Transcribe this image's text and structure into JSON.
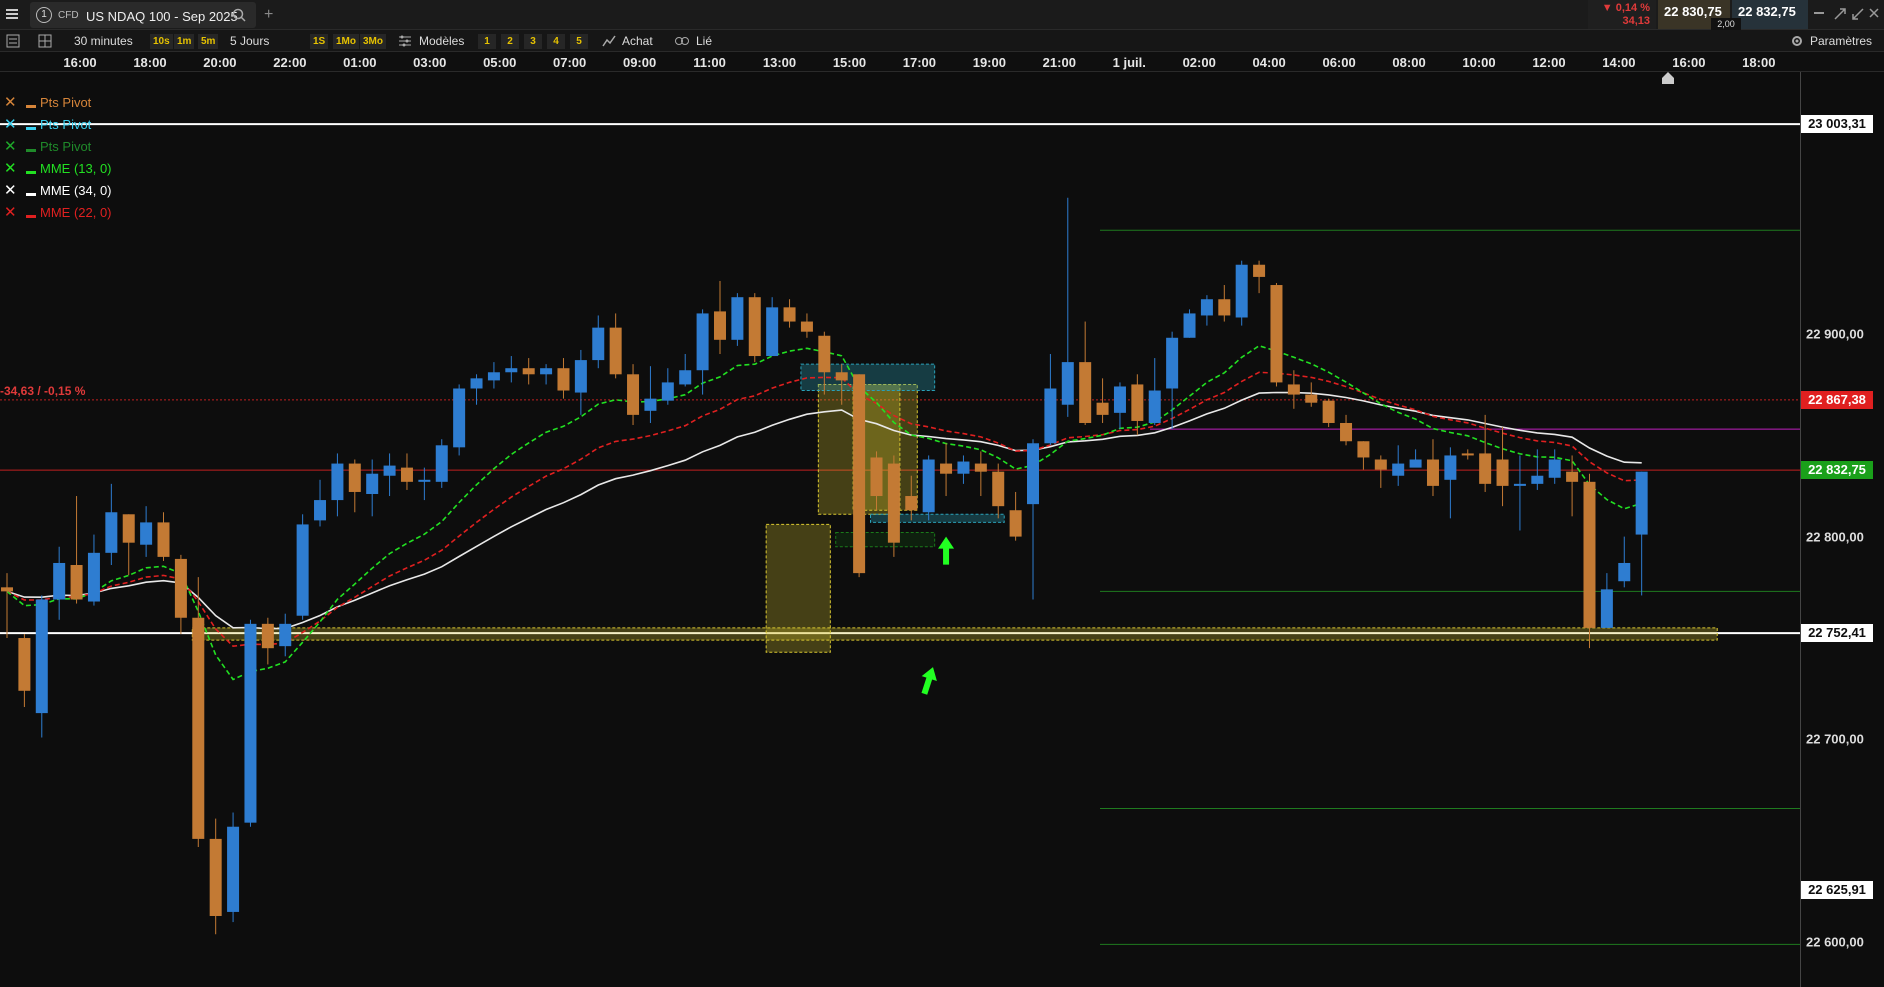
{
  "window": {
    "tab_number": "1",
    "tab_type": "CFD",
    "tab_title": "US NDAQ 100 - Sep 2025",
    "change_pct": "▼ 0,14 %",
    "change_abs": "34,13",
    "bid": "22 830,75",
    "ask": "22 832,75",
    "spread": "2,00"
  },
  "toolbar": {
    "interval": "30 minutes",
    "quick_intervals": [
      "10s",
      "1m",
      "5m"
    ],
    "period": "5 Jours",
    "quick_periods": [
      "1S",
      "1Mo",
      "3Mo"
    ],
    "models_label": "Modèles",
    "layout_buttons": [
      "1",
      "2",
      "3",
      "4",
      "5"
    ],
    "buy_label": "Achat",
    "link_label": "Lié",
    "settings_label": "Paramètres"
  },
  "time_axis": [
    "16:00",
    "18:00",
    "20:00",
    "22:00",
    "01:00",
    "03:00",
    "05:00",
    "07:00",
    "09:00",
    "11:00",
    "13:00",
    "15:00",
    "17:00",
    "19:00",
    "21:00",
    "1 juil.",
    "02:00",
    "04:00",
    "06:00",
    "08:00",
    "10:00",
    "12:00",
    "14:00",
    "16:00",
    "18:00"
  ],
  "legend": [
    {
      "label": "Pts Pivot",
      "color": "#d6853a",
      "x_color": "#d6853a"
    },
    {
      "label": "Pts Pivot",
      "color": "#3ad0f0",
      "x_color": "#3ad0f0"
    },
    {
      "label": "Pts Pivot",
      "color": "#1f8a2a",
      "x_color": "#1faa2a"
    },
    {
      "label": "MME (13, 0)",
      "color": "#22e022",
      "x_color": "#22e022"
    },
    {
      "label": "MME (34, 0)",
      "color": "#ffffff",
      "x_color": "#ffffff"
    },
    {
      "label": "MME (22, 0)",
      "color": "#e02020",
      "x_color": "#e02020"
    }
  ],
  "annotations": {
    "prev_close_change": "-34,63 / -0,15 %"
  },
  "price_axis": {
    "ticks": [
      "22 900,00",
      "22 800,00",
      "22 700,00",
      "22 600,00"
    ],
    "top_box": "23 003,31",
    "prev_close_box": "22 867,38",
    "last_box": "22 832,75",
    "support_box": "22 752,41",
    "low_box": "22 625,91"
  },
  "colors": {
    "bull": "#2e7dd1",
    "bear": "#c37a34",
    "ema13": "#22e022",
    "ema22": "#e02020",
    "ema34": "#e8e8e8",
    "pivot": "#1f7a1f",
    "zone": "#d8c630"
  },
  "chart_data": {
    "type": "candlestick",
    "instrument": "US NDAQ 100 - Sep 2025",
    "interval": "30 minutes",
    "ylim": [
      22578,
      23029
    ],
    "reference_levels": {
      "r_top": 23003.31,
      "pivot_r1": 22951,
      "prev_close": 22867.38,
      "magenta": 22853,
      "last": 22832.75,
      "pivot_s1": 22773,
      "support": 22752.41,
      "pivot_s2": 22666,
      "low": 22625.91,
      "pivot_s3": 22599
    },
    "candles": [
      [
        22775,
        22773,
        22782,
        22750
      ],
      [
        22750,
        22724,
        22752,
        22716
      ],
      [
        22713,
        22769,
        22771,
        22701
      ],
      [
        22769,
        22787,
        22795,
        22759
      ],
      [
        22786,
        22769,
        22820,
        22767
      ],
      [
        22768,
        22792,
        22801,
        22766
      ],
      [
        22792,
        22812,
        22826,
        22786
      ],
      [
        22811,
        22797,
        22811,
        22781
      ],
      [
        22796,
        22807,
        22815,
        22790
      ],
      [
        22807,
        22790,
        22812,
        22788
      ],
      [
        22789,
        22760,
        22791,
        22752
      ],
      [
        22760,
        22651,
        22780,
        22647
      ],
      [
        22651,
        22613,
        22661,
        22604
      ],
      [
        22615,
        22657,
        22664,
        22610
      ],
      [
        22659,
        22757,
        22759,
        22657
      ],
      [
        22757,
        22745,
        22760,
        22737
      ],
      [
        22746,
        22757,
        22762,
        22741
      ],
      [
        22761,
        22806,
        22811,
        22759
      ],
      [
        22808,
        22818,
        22828,
        22805
      ],
      [
        22818,
        22836,
        22841,
        22810
      ],
      [
        22836,
        22822,
        22838,
        22812
      ],
      [
        22821,
        22831,
        22838,
        22810
      ],
      [
        22830,
        22835,
        22841,
        22820
      ],
      [
        22834,
        22827,
        22841,
        22823
      ],
      [
        22827,
        22828,
        22834,
        22818
      ],
      [
        22827,
        22845,
        22848,
        22824
      ],
      [
        22844,
        22873,
        22875,
        22840
      ],
      [
        22873,
        22878,
        22880,
        22865
      ],
      [
        22877,
        22881,
        22886,
        22873
      ],
      [
        22881,
        22883,
        22889,
        22876
      ],
      [
        22883,
        22880,
        22888,
        22875
      ],
      [
        22880,
        22883,
        22885,
        22875
      ],
      [
        22883,
        22872,
        22888,
        22868
      ],
      [
        22871,
        22887,
        22892,
        22860
      ],
      [
        22887,
        22903,
        22909,
        22883
      ],
      [
        22903,
        22880,
        22910,
        22878
      ],
      [
        22880,
        22860,
        22885,
        22855
      ],
      [
        22862,
        22868,
        22884,
        22856
      ],
      [
        22867,
        22876,
        22883,
        22865
      ],
      [
        22875,
        22882,
        22890,
        22874
      ],
      [
        22882,
        22910,
        22912,
        22870
      ],
      [
        22911,
        22897,
        22926,
        22890
      ],
      [
        22897,
        22918,
        22920,
        22894
      ],
      [
        22918,
        22889,
        22920,
        22886
      ],
      [
        22889,
        22913,
        22918,
        22893
      ],
      [
        22913,
        22906,
        22917,
        22903
      ],
      [
        22906,
        22901,
        22910,
        22898
      ],
      [
        22899,
        22881,
        22901,
        22870
      ],
      [
        22881,
        22877,
        22885,
        22865
      ],
      [
        22880,
        22782,
        22880,
        22780
      ],
      [
        22839,
        22820,
        22842,
        22813
      ],
      [
        22836,
        22797,
        22840,
        22790
      ],
      [
        22820,
        22813,
        22830,
        22808
      ],
      [
        22812,
        22838,
        22840,
        22808
      ],
      [
        22836,
        22831,
        22846,
        22820
      ],
      [
        22831,
        22837,
        22840,
        22826
      ],
      [
        22836,
        22832,
        22842,
        22820
      ],
      [
        22832,
        22815,
        22836,
        22809
      ],
      [
        22813,
        22800,
        22822,
        22798
      ],
      [
        22816,
        22846,
        22848,
        22769
      ],
      [
        22846,
        22873,
        22890,
        22845
      ],
      [
        22865,
        22886,
        22967,
        22859
      ],
      [
        22886,
        22856,
        22906,
        22855
      ],
      [
        22866,
        22860,
        22878,
        22856
      ],
      [
        22861,
        22874,
        22876,
        22853
      ],
      [
        22875,
        22857,
        22880,
        22850
      ],
      [
        22856,
        22872,
        22888,
        22855
      ],
      [
        22873,
        22898,
        22901,
        22853
      ],
      [
        22898,
        22910,
        22912,
        22898
      ],
      [
        22909,
        22917,
        22919,
        22904
      ],
      [
        22917,
        22909,
        22924,
        22906
      ],
      [
        22908,
        22934,
        22936,
        22904
      ],
      [
        22934,
        22928,
        22936,
        22920
      ],
      [
        22924,
        22876,
        22925,
        22874
      ],
      [
        22875,
        22870,
        22882,
        22863
      ],
      [
        22870,
        22866,
        22876,
        22864
      ],
      [
        22867,
        22856,
        22868,
        22854
      ],
      [
        22856,
        22847,
        22860,
        22845
      ],
      [
        22847,
        22839,
        22847,
        22833
      ],
      [
        22838,
        22833,
        22840,
        22824
      ],
      [
        22830,
        22836,
        22845,
        22825
      ],
      [
        22834,
        22838,
        22843,
        22835
      ],
      [
        22838,
        22825,
        22848,
        22820
      ],
      [
        22828,
        22840,
        22844,
        22809
      ],
      [
        22841,
        22840,
        22843,
        22838
      ],
      [
        22841,
        22826,
        22860,
        22822
      ],
      [
        22838,
        22825,
        22854,
        22815
      ],
      [
        22825,
        22826,
        22840,
        22803
      ],
      [
        22826,
        22830,
        22843,
        22823
      ],
      [
        22829,
        22838,
        22843,
        22826
      ],
      [
        22832,
        22827,
        22840,
        22810
      ],
      [
        22827,
        22755,
        22831,
        22745
      ],
      [
        22755,
        22774,
        22782,
        22764
      ],
      [
        22778,
        22787,
        22800,
        22775
      ],
      [
        22801,
        22832,
        22832,
        22771
      ]
    ],
    "zones": [
      {
        "from_index": 11,
        "to_index": 98,
        "top": 22755,
        "bottom": 22749
      },
      {
        "from_index": 44,
        "to_index": 47,
        "top": 22806,
        "bottom": 22743
      },
      {
        "from_index": 47,
        "to_index": 51,
        "top": 22875,
        "bottom": 22811
      },
      {
        "from_index": 49,
        "to_index": 52,
        "top": 22875,
        "bottom": 22813
      },
      {
        "from_index": 46,
        "to_index": 53,
        "top": 22885,
        "bottom": 22872
      },
      {
        "from_index": 48,
        "to_index": 53,
        "top": 22802,
        "bottom": 22795
      },
      {
        "from_index": 50,
        "to_index": 57,
        "top": 22811,
        "bottom": 22807
      }
    ],
    "arrows": [
      {
        "index": 54,
        "price": 22800
      },
      {
        "index": 53,
        "price": 22736
      }
    ]
  }
}
